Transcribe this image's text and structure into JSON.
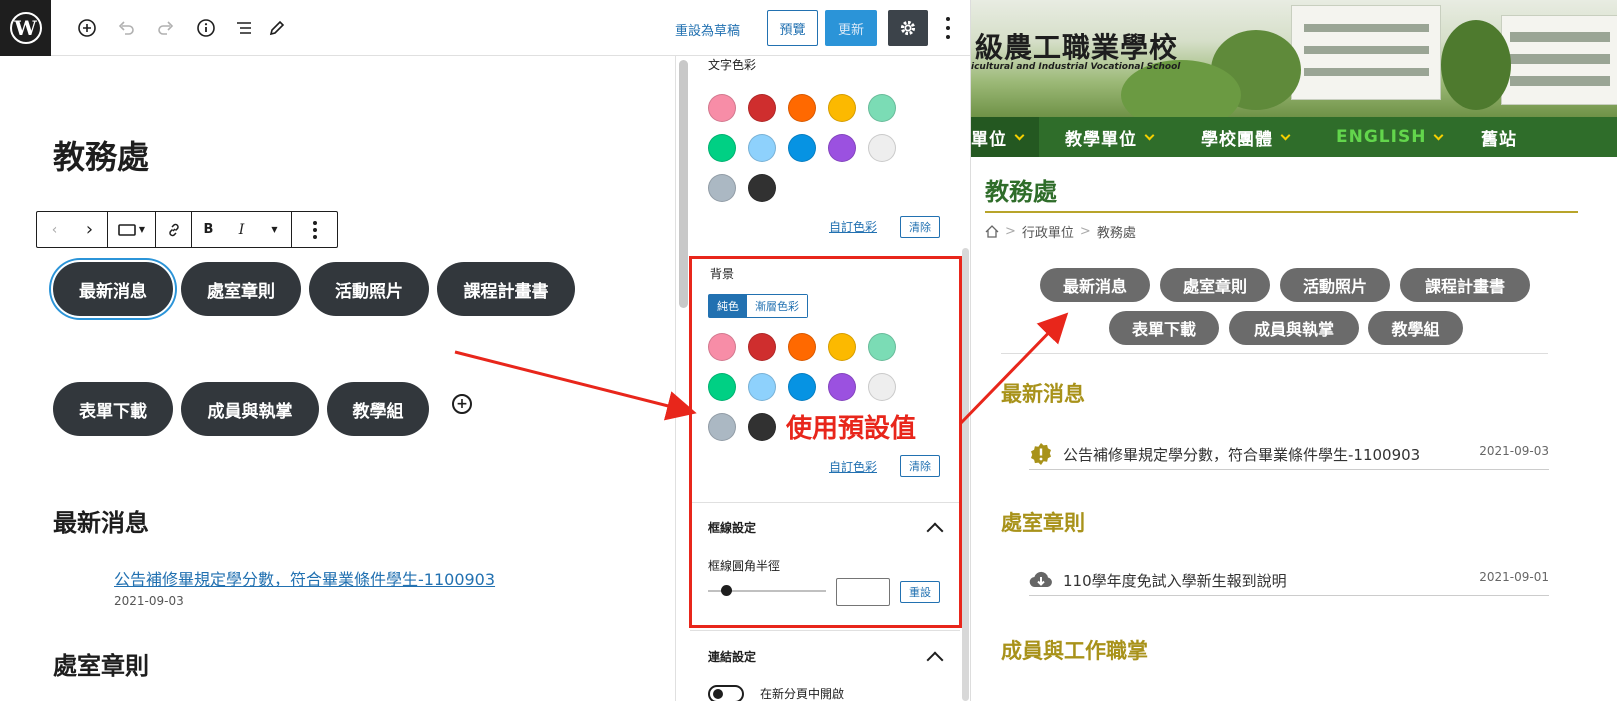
{
  "editor": {
    "toolbar": {
      "revert_label": "重設為草稿",
      "preview_label": "預覽",
      "update_label": "更新"
    },
    "page_title": "教務處",
    "block_toolbar": {
      "bold": "B",
      "italic": "I"
    },
    "buttons": [
      "最新消息",
      "處室章則",
      "活動照片",
      "課程計畫書",
      "表單下載",
      "成員與執掌",
      "教學組"
    ],
    "headings": [
      "最新消息",
      "處室章則"
    ],
    "news_link": "公告補修畢規定學分數，符合畢業條件學生-1100903",
    "news_date": "2021-09-03"
  },
  "sidebar": {
    "text_color_label": "文字色彩",
    "background_label": "背景",
    "solid_label": "純色",
    "gradient_label": "漸層色彩",
    "custom_color_label": "自訂色彩",
    "clear_label": "清除",
    "palette": [
      "#f78da7",
      "#cf2e2e",
      "#ff6900",
      "#fcb900",
      "#7bdcb5",
      "#00d084",
      "#8ed1fc",
      "#0693e3",
      "#9b51e0",
      "#eeeeee",
      "#abb8c3",
      "#313131"
    ],
    "border_panel_title": "框線設定",
    "border_radius_label": "框線圓角半徑",
    "reset_label": "重設",
    "link_panel_title": "連結設定",
    "new_tab_label": "在新分頁中開啟"
  },
  "annotation": {
    "text": "使用預設值",
    "color": "#e8261b"
  },
  "site": {
    "school_name": "級農工職業學校",
    "school_name_en": "icultural and Industrial Vocational School",
    "nav": [
      "單位",
      "教學單位",
      "學校團體",
      "ENGLISH",
      "舊站"
    ],
    "title": "教務處",
    "breadcrumb": [
      "行政單位",
      "教務處"
    ],
    "buttons": [
      "最新消息",
      "處室章則",
      "活動照片",
      "課程計畫書",
      "表單下載",
      "成員與執掌",
      "教學組"
    ],
    "sections": [
      {
        "heading": "最新消息",
        "item": "公告補修畢規定學分數，符合畢業條件學生-1100903",
        "date": "2021-09-03"
      },
      {
        "heading": "處室章則",
        "item": "110學年度免試入學新生報到說明",
        "date": "2021-09-01"
      },
      {
        "heading": "成員與工作職掌"
      }
    ],
    "colors": {
      "nav_green": "#2f6d2a",
      "heading_gold": "#a8921a",
      "button_gray": "#6b6b6b"
    }
  }
}
